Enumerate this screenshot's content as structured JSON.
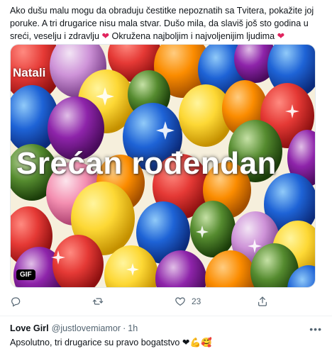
{
  "tweet": {
    "text_part1": "Ako dušu malu mogu da obraduju čestitke nepoznatih sa Tvitera, pokažite joj poruke. A tri drugarice nisu mala stvar. Dušo mila, da slaviš još sto godina u sreći, veselju i zdravlju",
    "heart_1": "❤",
    "text_part2": " Okružena najboljim i najvoljenijim ljudima ",
    "heart_2": "❤"
  },
  "media": {
    "watermark": "Natali",
    "title": "Srećan rođendan",
    "badge": "GIF"
  },
  "actions": {
    "like_count": "23",
    "reply_icon": "reply-icon",
    "retweet_icon": "retweet-icon",
    "like_icon": "heart-icon",
    "share_icon": "share-icon"
  },
  "reply": {
    "name": "Love Girl",
    "handle": "@justlovemiamor",
    "separator": "·",
    "time": "1h",
    "more": "•••",
    "text": "Apsolutno, tri drugarice su pravo bogatstvo ",
    "emojis": "❤💪🥰"
  },
  "colors": {
    "text": "#0f1419",
    "secondary": "#536471",
    "heart": "#e0245e"
  }
}
